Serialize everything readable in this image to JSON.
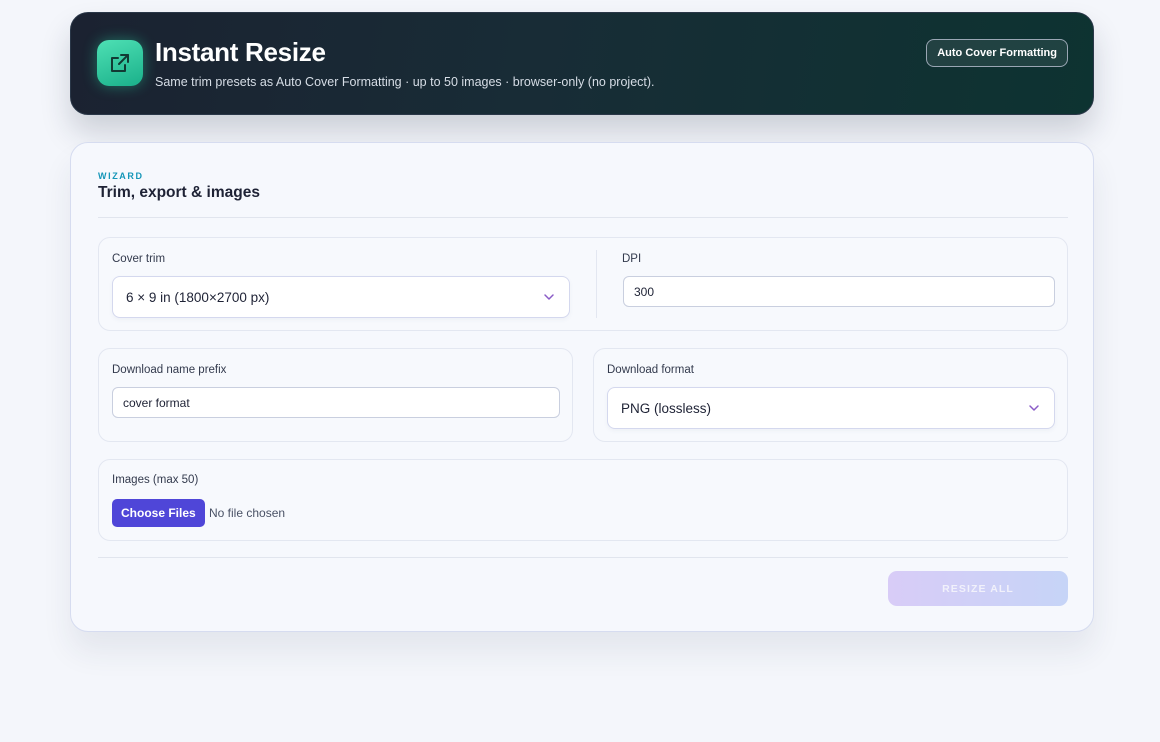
{
  "header": {
    "title": "Instant Resize",
    "subtitle": "Same trim presets as Auto Cover Formatting · up to 50 images · browser-only (no project).",
    "link_button": "Auto Cover Formatting",
    "icon": "external-resize-icon"
  },
  "wizard": {
    "eyebrow": "WIZARD",
    "title": "Trim, export & images",
    "cover_trim": {
      "label": "Cover trim",
      "selected": "6 × 9 in (1800×2700 px)"
    },
    "dpi": {
      "label": "DPI",
      "value": "300"
    },
    "name_prefix": {
      "label": "Download name prefix",
      "value": "cover format"
    },
    "format": {
      "label": "Download format",
      "selected": "PNG (lossless)"
    },
    "images": {
      "label": "Images (max 50)",
      "choose_button": "Choose Files",
      "status": "No file chosen"
    },
    "resize_button": "RESIZE ALL"
  },
  "colors": {
    "accent": "#4f46d8",
    "eyebrow": "#1596b8",
    "icon_green": "#1ab08a"
  }
}
